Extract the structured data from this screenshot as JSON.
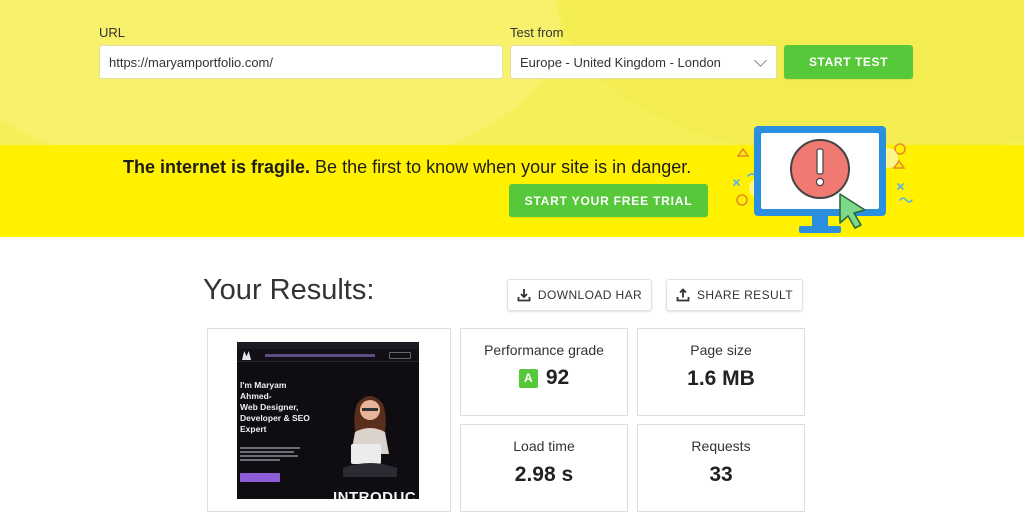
{
  "form": {
    "url_label": "URL",
    "url_value": "https://maryamportfolio.com/",
    "test_from_label": "Test from",
    "test_from_value": "Europe - United Kingdom - London",
    "start_test_label": "START TEST"
  },
  "promo": {
    "headline_bold": "The internet is fragile.",
    "headline_rest": " Be the first to know when your site is in danger.",
    "trial_button_label": "START YOUR FREE TRIAL"
  },
  "results": {
    "title": "Your Results:",
    "download_har_label": "DOWNLOAD HAR",
    "share_result_label": "SHARE RESULT",
    "metrics": {
      "performance_grade": {
        "label": "Performance grade",
        "grade": "A",
        "value": "92"
      },
      "page_size": {
        "label": "Page size",
        "value": "1.6 MB"
      },
      "load_time": {
        "label": "Load time",
        "value": "2.98 s"
      },
      "requests": {
        "label": "Requests",
        "value": "33"
      }
    },
    "preview": {
      "heading": "I'm Maryam\nAhmed-\nWeb Designer,\nDeveloper & SEO\nExpert",
      "footer_text": "INTRODUC"
    }
  },
  "colors": {
    "top_band": "#f5ef5a",
    "promo_band": "#fff100",
    "accent_green": "#56c83a",
    "alert_red": "#f07a72",
    "monitor_blue": "#2b8fe0"
  },
  "icons": {
    "download": "download-icon",
    "share": "share-icon",
    "dropdown": "chevron-down-icon",
    "alert": "exclamation-icon",
    "cursor": "cursor-arrow-icon"
  }
}
